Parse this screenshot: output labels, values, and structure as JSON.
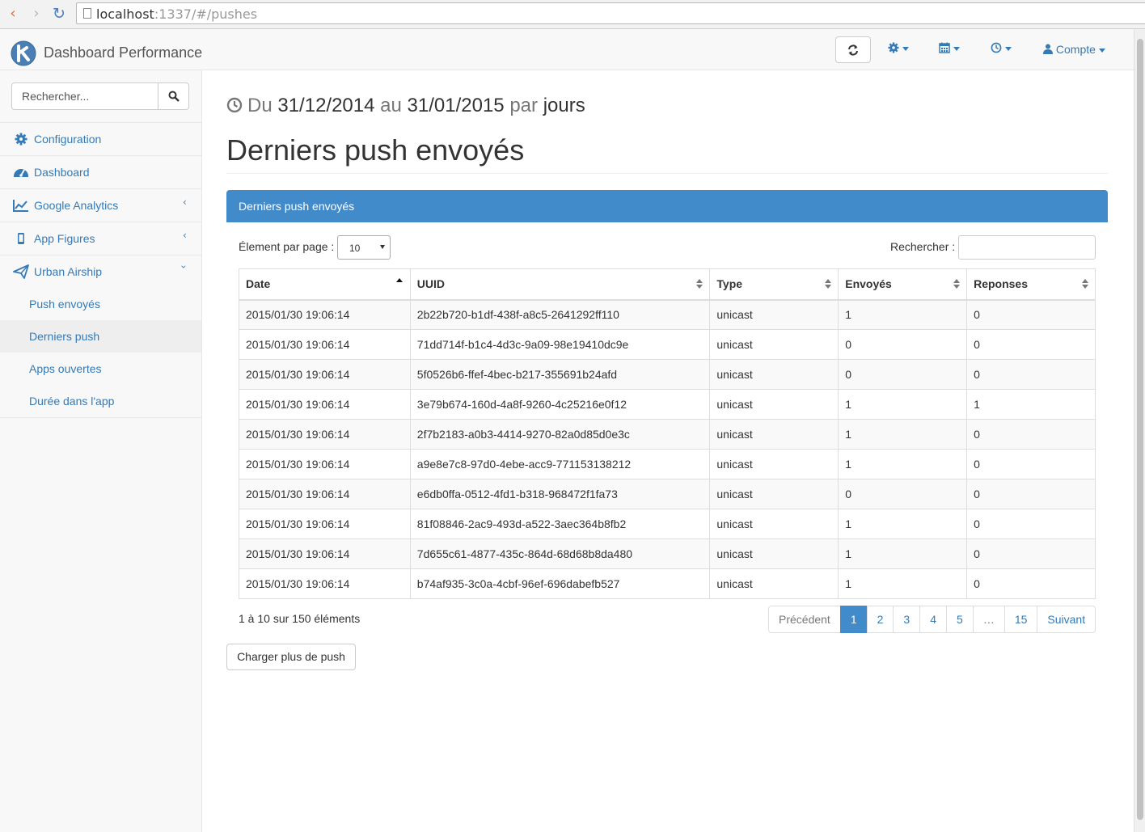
{
  "browser": {
    "url_host": "localhost",
    "url_rest": ":1337/#/pushes"
  },
  "navbar": {
    "brand": "Dashboard Performance",
    "account_label": "Compte"
  },
  "sidebar": {
    "search_placeholder": "Rechercher...",
    "items": [
      {
        "label": "Configuration"
      },
      {
        "label": "Dashboard"
      },
      {
        "label": "Google Analytics"
      },
      {
        "label": "App Figures"
      },
      {
        "label": "Urban Airship"
      }
    ],
    "subitems": [
      {
        "label": "Push envoyés"
      },
      {
        "label": "Derniers push"
      },
      {
        "label": "Apps ouvertes"
      },
      {
        "label": "Durée dans l'app"
      }
    ]
  },
  "header": {
    "du": "Du",
    "date_from": "31/12/2014",
    "au": "au",
    "date_to": "31/01/2015",
    "par": "par",
    "period": "jours",
    "title": "Derniers push envoyés"
  },
  "panel": {
    "heading": "Derniers push envoyés",
    "length_label": "Élement par page :",
    "length_value": "10",
    "filter_label": "Rechercher :",
    "columns": [
      "Date",
      "UUID",
      "Type",
      "Envoyés",
      "Reponses"
    ],
    "rows": [
      [
        "2015/01/30 19:06:14",
        "2b22b720-b1df-438f-a8c5-2641292ff110",
        "unicast",
        "1",
        "0"
      ],
      [
        "2015/01/30 19:06:14",
        "71dd714f-b1c4-4d3c-9a09-98e19410dc9e",
        "unicast",
        "0",
        "0"
      ],
      [
        "2015/01/30 19:06:14",
        "5f0526b6-ffef-4bec-b217-355691b24afd",
        "unicast",
        "0",
        "0"
      ],
      [
        "2015/01/30 19:06:14",
        "3e79b674-160d-4a8f-9260-4c25216e0f12",
        "unicast",
        "1",
        "1"
      ],
      [
        "2015/01/30 19:06:14",
        "2f7b2183-a0b3-4414-9270-82a0d85d0e3c",
        "unicast",
        "1",
        "0"
      ],
      [
        "2015/01/30 19:06:14",
        "a9e8e7c8-97d0-4ebe-acc9-771153138212",
        "unicast",
        "1",
        "0"
      ],
      [
        "2015/01/30 19:06:14",
        "e6db0ffa-0512-4fd1-b318-968472f1fa73",
        "unicast",
        "0",
        "0"
      ],
      [
        "2015/01/30 19:06:14",
        "81f08846-2ac9-493d-a522-3aec364b8fb2",
        "unicast",
        "1",
        "0"
      ],
      [
        "2015/01/30 19:06:14",
        "7d655c61-4877-435c-864d-68d68b8da480",
        "unicast",
        "1",
        "0"
      ],
      [
        "2015/01/30 19:06:14",
        "b74af935-3c0a-4cbf-96ef-696dabefb527",
        "unicast",
        "1",
        "0"
      ]
    ],
    "info": "1 à 10 sur 150 éléments",
    "pagination": {
      "previous": "Précédent",
      "pages": [
        "1",
        "2",
        "3",
        "4",
        "5",
        "…",
        "15"
      ],
      "next": "Suivant"
    },
    "load_more": "Charger plus de push"
  },
  "colors": {
    "primary": "#428bca",
    "link": "#337ab7"
  }
}
